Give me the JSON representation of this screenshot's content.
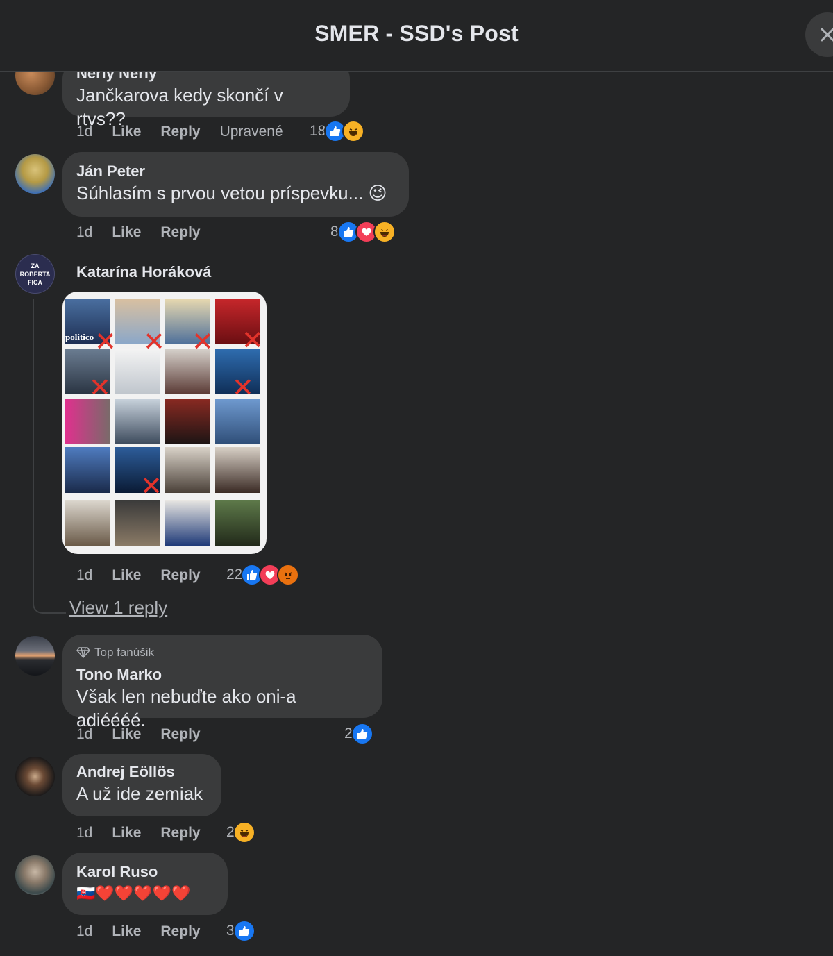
{
  "header": {
    "title": "SMER - SSD's Post"
  },
  "comments": [
    {
      "name": "Neřly Neřly",
      "text": "Jančkarova kedy skončí v rtvs??",
      "time": "1d",
      "like": "Like",
      "reply": "Reply",
      "edited": "Upravené",
      "reactions": {
        "count": "18",
        "types": [
          "like-icon",
          "haha-icon"
        ]
      }
    },
    {
      "name": "Ján Peter",
      "text": "Súhlasím s prvou vetou príspevku... 😉",
      "time": "1d",
      "like": "Like",
      "reply": "Reply",
      "reactions": {
        "count": "8",
        "types": [
          "like-icon",
          "love-icon",
          "haha-icon"
        ]
      }
    },
    {
      "name": "Katarína Horáková",
      "avatar_text": "ZA ROBERTA FICA",
      "photo_text": "politico",
      "time": "1d",
      "like": "Like",
      "reply": "Reply",
      "reactions": {
        "count": "22",
        "types": [
          "like-icon",
          "love-icon",
          "angry-icon"
        ]
      },
      "view_replies": "View 1 reply"
    },
    {
      "badge": "Top fanúšik",
      "name": "Tono Marko",
      "text": "Však len nebuďte ako oni-a adiéééé.",
      "time": "1d",
      "like": "Like",
      "reply": "Reply",
      "reactions": {
        "count": "2",
        "types": [
          "like-icon"
        ]
      }
    },
    {
      "name": "Andrej Eöllös",
      "text": "A už ide zemiak",
      "time": "1d",
      "like": "Like",
      "reply": "Reply",
      "reactions": {
        "count": "2",
        "types": [
          "haha-icon"
        ]
      }
    },
    {
      "name": "Karol Ruso",
      "text": "🇸🇰❤️❤️❤️❤️❤️",
      "time": "1d",
      "like": "Like",
      "reply": "Reply",
      "reactions": {
        "count": "3",
        "types": [
          "like-icon"
        ]
      }
    }
  ],
  "colors": {
    "background": "#242526",
    "bubble": "#3a3b3c",
    "like": "#1877f2",
    "love": "#f33e58",
    "haha": "#f7b125",
    "angry": "#e9710f",
    "cross": "#e2332b"
  }
}
